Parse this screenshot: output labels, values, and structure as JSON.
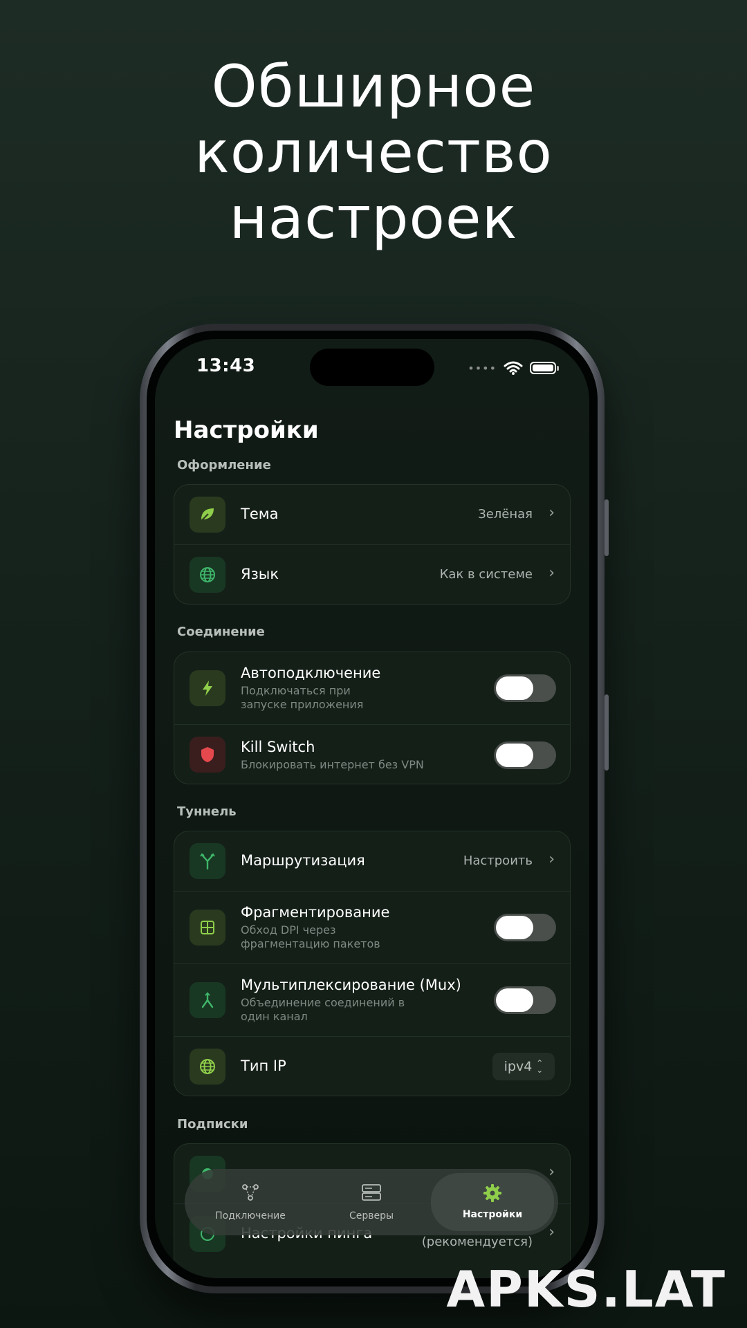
{
  "headline": [
    "Обширное",
    "количество",
    "настроек"
  ],
  "status_bar": {
    "time": "13:43"
  },
  "page_title": "Настройки",
  "sections": {
    "appearance": {
      "label": "Оформление",
      "theme": {
        "title": "Тема",
        "value": "Зелёная",
        "icon": "leaf-icon"
      },
      "language": {
        "title": "Язык",
        "value": "Как в системе",
        "icon": "globe-icon"
      }
    },
    "connection": {
      "label": "Соединение",
      "autoconnect": {
        "title": "Автоподключение",
        "subtitle": [
          "Подключаться при",
          "запуске приложения"
        ],
        "icon": "bolt-icon",
        "enabled": false
      },
      "killswitch": {
        "title": "Kill Switch",
        "subtitle": "Блокировать интернет без VPN",
        "icon": "shield-icon",
        "enabled": false
      }
    },
    "tunnel": {
      "label": "Туннель",
      "routing": {
        "title": "Маршрутизация",
        "value": "Настроить",
        "icon": "route-split-icon"
      },
      "fragmentation": {
        "title": "Фрагментирование",
        "subtitle": [
          "Обход DPI через",
          "фрагментацию пакетов"
        ],
        "icon": "grid-icon",
        "enabled": false
      },
      "mux": {
        "title": "Мультиплексирование (Mux)",
        "subtitle": [
          "Объединение соединений в",
          "один канал"
        ],
        "icon": "merge-icon",
        "enabled": false
      },
      "ip_type": {
        "title": "Тип IP",
        "value": "ipv4",
        "icon": "globe-icon"
      }
    },
    "subscriptions": {
      "label": "Подписки",
      "ping_settings": {
        "title": "Настройки пинга",
        "value": "(рекомендуется)"
      }
    }
  },
  "tabbar": {
    "tabs": [
      {
        "label": "Подключение",
        "icon": "nodes-icon"
      },
      {
        "label": "Серверы",
        "icon": "server-icon"
      },
      {
        "label": "Настройки",
        "icon": "gear-icon",
        "active": true
      }
    ]
  },
  "watermark": "APKS.LAT",
  "colors": {
    "accent": "#8fce4a",
    "icon_green": "#3fb56a",
    "danger": "#e5484d"
  }
}
